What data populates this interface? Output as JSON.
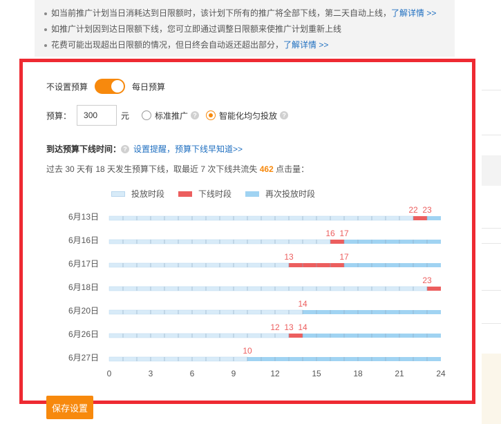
{
  "notice": {
    "items": [
      {
        "text": "如当前推广计划当日消耗达到日限额时，该计划下所有的推广将全部下线，第二天自动上线，",
        "link": "了解详情 >>"
      },
      {
        "text": "如推广计划因到达日限额下线，您可立即通过调整日限额来使推广计划重新上线",
        "link": ""
      },
      {
        "text": "花费可能出现超出日限额的情况，但日终会自动返还超出部分，",
        "link": "了解详情 >>"
      }
    ]
  },
  "budget_mode": {
    "left_label": "不设置预算",
    "right_label": "每日预算",
    "toggle_on": true
  },
  "budget": {
    "label": "预算：",
    "value": "300",
    "unit": "元",
    "options": [
      {
        "label": "标准推广",
        "selected": false
      },
      {
        "label": "智能化均匀投放",
        "selected": true
      }
    ]
  },
  "offline": {
    "title": "到达预算下线时间：",
    "link": "设置提醒，预算下线早知道>>"
  },
  "stats": {
    "prefix": "过去 30 天有 18 天发生预算下线，取最近 7 次下线共流失",
    "lost_clicks": "462",
    "suffix": "点击量："
  },
  "legend": [
    {
      "label": "投放时段",
      "color": "#d8ebf8"
    },
    {
      "label": "下线时段",
      "color": "#ec5e5e"
    },
    {
      "label": "再次投放时段",
      "color": "#a0d3f2"
    }
  ],
  "chart_data": {
    "type": "bar",
    "x_range": [
      0,
      24
    ],
    "x_ticks": [
      "0",
      "3",
      "6",
      "9",
      "12",
      "15",
      "18",
      "21",
      "24"
    ],
    "rows": [
      {
        "date": "6月13日",
        "offline_start": 22,
        "offline_end": 23,
        "labels": [
          "22",
          "23"
        ]
      },
      {
        "date": "6月16日",
        "offline_start": 16,
        "offline_end": 17,
        "labels": [
          "16",
          "17"
        ]
      },
      {
        "date": "6月17日",
        "offline_start": 13,
        "offline_end": 17,
        "labels": [
          "13",
          "17"
        ]
      },
      {
        "date": "6月18日",
        "offline_start": 23,
        "offline_end": 24,
        "labels": [
          "23"
        ]
      },
      {
        "date": "6月20日",
        "offline_start": 14,
        "offline_end": 14,
        "labels": [
          "14"
        ]
      },
      {
        "date": "6月26日",
        "offline_start": 13,
        "offline_end": 14,
        "labels": [
          "12",
          "13",
          "14"
        ],
        "label_hours": [
          12,
          13,
          14
        ]
      },
      {
        "date": "6月27日",
        "offline_start": 10,
        "offline_end": 10,
        "labels": [
          "10"
        ]
      }
    ],
    "colors": {
      "serving": "#d8ebf8",
      "offline": "#ec5e5e",
      "reserving": "#a0d3f2"
    }
  },
  "save_button": "保存设置"
}
